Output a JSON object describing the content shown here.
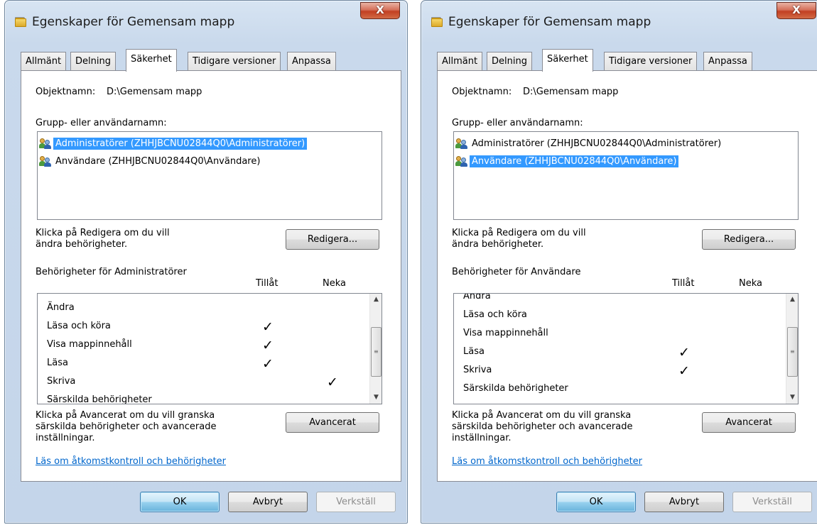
{
  "dialogs": [
    {
      "title": "Egenskaper för Gemensam mapp",
      "close_glyph": "X",
      "tabs": [
        "Allmänt",
        "Delning",
        "Säkerhet",
        "Tidigare versioner",
        "Anpassa"
      ],
      "active_tab": "Säkerhet",
      "object_label": "Objektnamn:",
      "object_value": "D:\\Gemensam mapp",
      "group_label": "Grupp- eller användarnamn:",
      "users": [
        {
          "name": "Administratörer (ZHHJBCNU02844Q0\\Administratörer)",
          "selected": true,
          "icon": "users-group-icon"
        },
        {
          "name": "Användare (ZHHJBCNU02844Q0\\Användare)",
          "selected": false,
          "icon": "users-group-icon"
        }
      ],
      "edit_hint": "Klicka på Redigera om du vill\nändra behörigheter.",
      "edit_button": "Redigera...",
      "perm_header": "Behörigheter för Administratörer",
      "allow_header": "Tillåt",
      "deny_header": "Neka",
      "permissions": [
        {
          "name": "Ändra",
          "allow": "",
          "deny": ""
        },
        {
          "name": "Läsa och köra",
          "allow": "✓",
          "deny": ""
        },
        {
          "name": "Visa mappinnehåll",
          "allow": "✓",
          "deny": ""
        },
        {
          "name": "Läsa",
          "allow": "✓",
          "deny": ""
        },
        {
          "name": "Skriva",
          "allow": "",
          "deny": "✓"
        },
        {
          "name": "Särskilda behörigheter",
          "allow": "",
          "deny": ""
        }
      ],
      "advanced_hint": "Klicka på Avancerat om du vill granska\nsärskilda behörigheter och avancerade\ninställningar.",
      "advanced_button": "Avancerat",
      "learn_link": "Läs om åtkomstkontroll och behörigheter",
      "ok_button": "OK",
      "cancel_button": "Avbryt",
      "apply_button": "Verkställ"
    },
    {
      "title": "Egenskaper för Gemensam mapp",
      "close_glyph": "X",
      "tabs": [
        "Allmänt",
        "Delning",
        "Säkerhet",
        "Tidigare versioner",
        "Anpassa"
      ],
      "active_tab": "Säkerhet",
      "object_label": "Objektnamn:",
      "object_value": "D:\\Gemensam mapp",
      "group_label": "Grupp- eller användarnamn:",
      "users": [
        {
          "name": "Administratörer (ZHHJBCNU02844Q0\\Administratörer)",
          "selected": false,
          "icon": "users-group-icon"
        },
        {
          "name": "Användare (ZHHJBCNU02844Q0\\Användare)",
          "selected": true,
          "icon": "users-group-icon"
        }
      ],
      "edit_hint": "Klicka på Redigera om du vill\nändra behörigheter.",
      "edit_button": "Redigera...",
      "perm_header": "Behörigheter för Användare",
      "allow_header": "Tillåt",
      "deny_header": "Neka",
      "permissions": [
        {
          "name": "Ändra",
          "allow": "",
          "deny": ""
        },
        {
          "name": "Läsa och köra",
          "allow": "",
          "deny": ""
        },
        {
          "name": "Visa mappinnehåll",
          "allow": "",
          "deny": ""
        },
        {
          "name": "Läsa",
          "allow": "✓",
          "deny": ""
        },
        {
          "name": "Skriva",
          "allow": "✓",
          "deny": ""
        },
        {
          "name": "Särskilda behörigheter",
          "allow": "",
          "deny": ""
        }
      ],
      "advanced_hint": "Klicka på Avancerat om du vill granska\nsärskilda behörigheter och avancerade\ninställningar.",
      "advanced_button": "Avancerat",
      "learn_link": "Läs om åtkomstkontroll och behörigheter",
      "ok_button": "OK",
      "cancel_button": "Avbryt",
      "apply_button": "Verkställ"
    }
  ],
  "colors": {
    "selection": "#3399ff",
    "link": "#0066cc",
    "close_button": "#c23f22"
  }
}
